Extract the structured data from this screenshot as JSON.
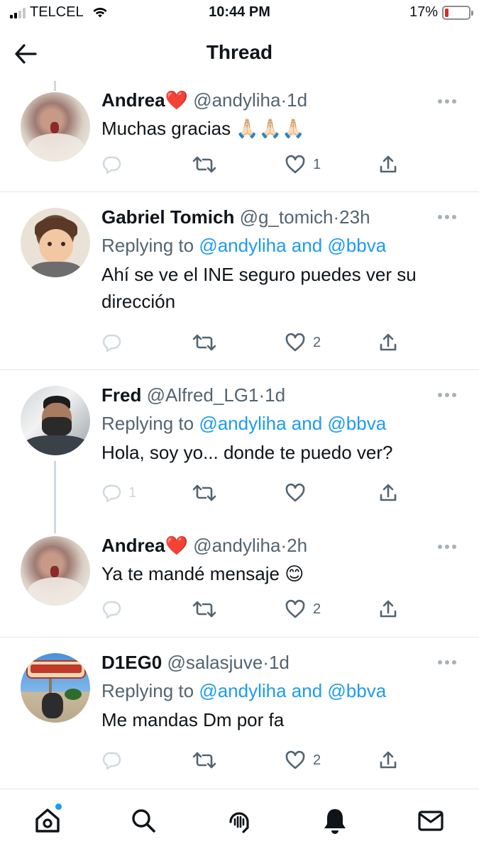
{
  "status_bar": {
    "carrier": "TELCEL",
    "time": "10:44 PM",
    "battery_percent": "17%",
    "battery_level": 0.17,
    "signal_bars_active": 2,
    "signal_bars_total": 4
  },
  "header": {
    "title": "Thread",
    "back_icon": "arrow-left-icon"
  },
  "colors": {
    "accent": "#1d9bf0",
    "secondary_text": "#536471",
    "battery_low": "#e0282b"
  },
  "tweets": [
    {
      "name": "Andrea",
      "name_emoji": "❤️",
      "handle": "@andyliha",
      "sep": "·",
      "time": "1d",
      "replying_prefix": "",
      "replying_users": "",
      "text": "Muchas gracias 🙏🏻🙏🏻🙏🏻",
      "reply_count": "",
      "like_count": "1"
    },
    {
      "name": "Gabriel Tomich",
      "handle": "@g_tomich",
      "sep": "·",
      "time": "23h",
      "replying_prefix": "Replying to ",
      "replying_users": "@andyliha and @bbva",
      "text": "Ahí se ve el INE seguro puedes ver su dirección",
      "reply_count": "",
      "like_count": "2"
    },
    {
      "name": "Fred",
      "handle": "@Alfred_LG1",
      "sep": "·",
      "time": "1d",
      "replying_prefix": "Replying to ",
      "replying_users": "@andyliha and @bbva",
      "text": "Hola, soy yo... donde te puedo ver?",
      "reply_count": "1",
      "like_count": ""
    },
    {
      "name": "Andrea",
      "name_emoji": "❤️",
      "handle": "@andyliha",
      "sep": "·",
      "time": "2h",
      "replying_prefix": "",
      "replying_users": "",
      "text": "Ya te mandé mensaje 😊",
      "reply_count": "",
      "like_count": "2"
    },
    {
      "name": "D1EG0",
      "handle": "@salasjuve",
      "sep": "·",
      "time": "1d",
      "replying_prefix": "Replying to ",
      "replying_users": "@andyliha and @bbva",
      "text": "Me mandas Dm por fa",
      "reply_count": "",
      "like_count": "2"
    }
  ],
  "tabs": [
    {
      "icon": "home-icon",
      "has_notification_dot": true
    },
    {
      "icon": "search-icon"
    },
    {
      "icon": "spaces-icon"
    },
    {
      "icon": "bell-icon"
    },
    {
      "icon": "mail-icon"
    }
  ]
}
